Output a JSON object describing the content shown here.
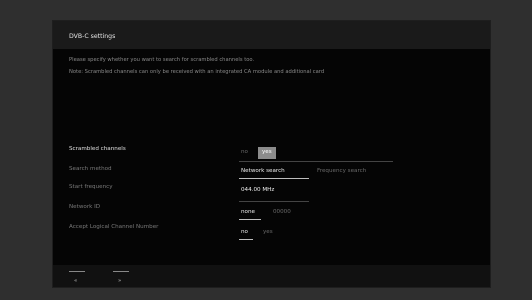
{
  "dialog": {
    "title": "DVB-C settings",
    "info_line1": "Please specify whether you want to search for scrambled channels too.",
    "info_line2": "Note: Scrambled channels can only be received with an integrated CA module and additional card"
  },
  "settings": {
    "scrambled": {
      "label": "Scrambled channels",
      "options": [
        "no",
        "yes"
      ],
      "selected": "yes"
    },
    "search_method": {
      "label": "Search method",
      "options": [
        "Network search",
        "Frequency search"
      ],
      "selected": "Network search"
    },
    "start_frequency": {
      "label": "Start frequency",
      "value": "044.00 MHz"
    },
    "network_id": {
      "label": "Network ID",
      "options": [
        "none",
        "00000"
      ],
      "selected": "none"
    },
    "lcn": {
      "label": "Accept Logical Channel Number",
      "options": [
        "no",
        "yes"
      ],
      "selected": "no"
    }
  },
  "nav": {
    "back_label": "«",
    "forward_label": "»"
  },
  "colors": {
    "frame": "#2f2f2f",
    "screen": "#050505",
    "selected_box": "#8c8c8c"
  }
}
